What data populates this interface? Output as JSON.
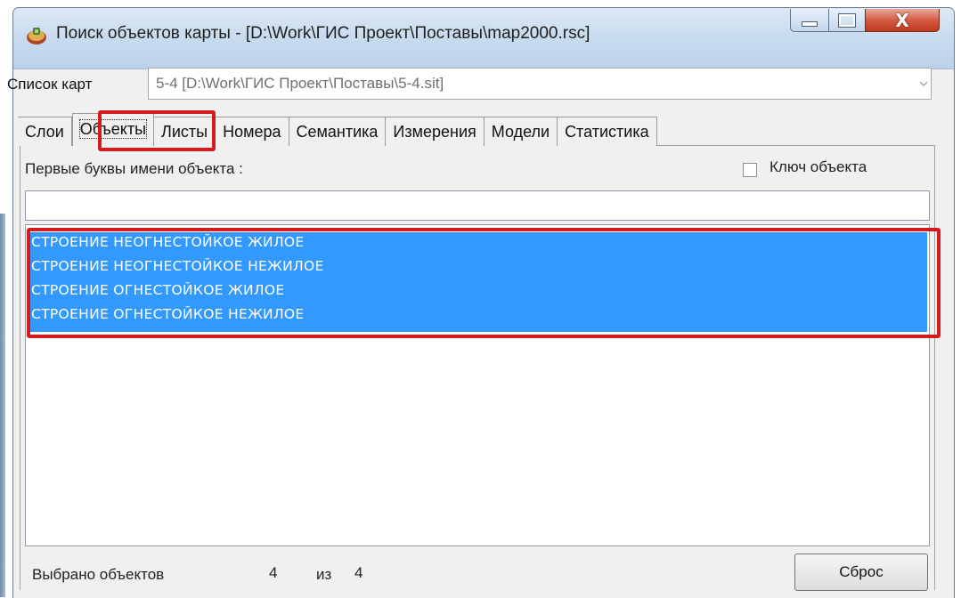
{
  "window": {
    "title": "Поиск объектов карты - [D:\\Work\\ГИС Проект\\Поставы\\map2000.rsc]",
    "app_icon": "map-app-icon",
    "controls": {
      "minimize": "minimize-icon",
      "maximize": "maximize-icon",
      "close": "close-icon",
      "close_glyph": "X"
    }
  },
  "map_list": {
    "label": "Список карт",
    "value": "5-4 [D:\\Work\\ГИС Проект\\Поставы\\5-4.sit]"
  },
  "tabs": [
    {
      "label": "Слои",
      "active": false
    },
    {
      "label": "Объекты",
      "active": true
    },
    {
      "label": "Листы",
      "active": false
    },
    {
      "label": "Номера",
      "active": false
    },
    {
      "label": "Семантика",
      "active": false
    },
    {
      "label": "Измерения",
      "active": false
    },
    {
      "label": "Модели",
      "active": false
    },
    {
      "label": "Статистика",
      "active": false
    }
  ],
  "objects_panel": {
    "first_letters_label": "Первые буквы имени объекта :",
    "name_input_value": "",
    "object_key_label": "Ключ объекта",
    "object_key_checked": false,
    "items": [
      {
        "label": "СТРОЕНИЕ НЕОГНЕСТОЙКОЕ ЖИЛОЕ",
        "selected": true
      },
      {
        "label": "СТРОЕНИЕ НЕОГНЕСТОЙКОЕ НЕЖИЛОЕ",
        "selected": true
      },
      {
        "label": "СТРОЕНИЕ ОГНЕСТОЙКОЕ ЖИЛОЕ",
        "selected": true
      },
      {
        "label": "СТРОЕНИЕ ОГНЕСТОЙКОЕ НЕЖИЛОЕ",
        "selected": true
      }
    ]
  },
  "status": {
    "selected_label": "Выбрано объектов",
    "selected_count": "4",
    "of_label": "из",
    "total_count": "4"
  },
  "reset_button": {
    "label": "Сброс"
  },
  "colors": {
    "selection": "#3399ff",
    "annotation": "#d41b1b",
    "window_bg": "#f0f0f0"
  }
}
